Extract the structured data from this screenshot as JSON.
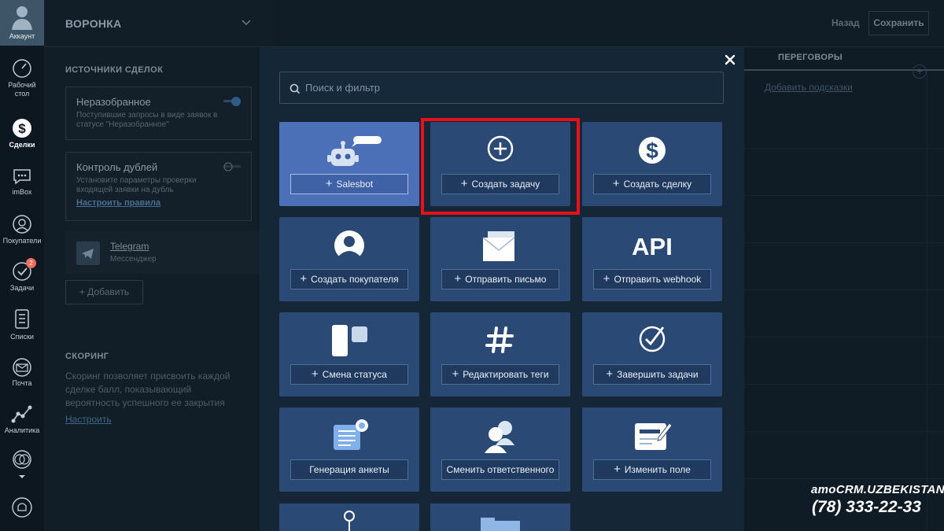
{
  "nav": {
    "account_label": "Аккаунт",
    "items": [
      {
        "label": "Рабочий стол",
        "icon": "dashboard-gauge-icon"
      },
      {
        "label": "Сделки",
        "icon": "deals-dollar-icon"
      },
      {
        "label": "imBox",
        "icon": "chat-bubble-icon"
      },
      {
        "label": "Покупатели",
        "icon": "customer-icon"
      },
      {
        "label": "Задачи",
        "icon": "tasks-check-icon",
        "badge": "2"
      },
      {
        "label": "Списки",
        "icon": "lists-icon"
      },
      {
        "label": "Почта",
        "icon": "mail-envelope-icon"
      },
      {
        "label": "Аналитика",
        "icon": "analytics-chart-icon"
      }
    ]
  },
  "panel": {
    "title": "ВОРОНКА",
    "sources_title": "ИСТОЧНИКИ СДЕЛОК",
    "unsorted": {
      "name": "Неразобранное",
      "desc": "Поступившие запросы в виде заявок в статусе \"Неразобранное\""
    },
    "duplicates": {
      "name": "Контроль дублей",
      "desc": "Установите параметры проверки входящей заявки на дубль",
      "link": "Настроить правила"
    },
    "telegram": {
      "name": "Telegram",
      "sub": "Мессенджер"
    },
    "add_button": "+ Добавить",
    "scoring_title": "СКОРИНГ",
    "scoring_desc": "Скоринг позволяет присвоить каждой сделке балл, показывающий вероятность успешного ее закрытия",
    "scoring_link": "Настроить"
  },
  "header": {
    "back": "Назад",
    "save": "Сохранить"
  },
  "column": {
    "name": "ПЕРЕГОВОРЫ",
    "hints_link": "Добавить подсказки"
  },
  "modal": {
    "close": "×",
    "search_placeholder": "Поиск и фильтр",
    "tiles": [
      {
        "label": "Salesbot",
        "icon": "robot-icon"
      },
      {
        "label": "Создать задачу",
        "icon": "plus-circle-icon"
      },
      {
        "label": "Создать сделку",
        "icon": "dollar-coin-icon"
      },
      {
        "label": "Создать покупателя",
        "icon": "customer-head-icon"
      },
      {
        "label": "Отправить письмо",
        "icon": "envelope-icon"
      },
      {
        "label": "Отправить webhook",
        "icon": "api-icon"
      },
      {
        "label": "Смена статуса",
        "icon": "status-cards-icon"
      },
      {
        "label": "Редактировать теги",
        "icon": "hashtag-icon"
      },
      {
        "label": "Завершить задачи",
        "icon": "check-circle-icon"
      },
      {
        "label": "Генерация анкеты",
        "icon": "form-list-icon"
      },
      {
        "label": "Сменить ответственного",
        "icon": "swap-users-icon"
      },
      {
        "label": "Изменить поле",
        "icon": "edit-field-icon"
      }
    ],
    "api_text": "API"
  },
  "watermark": {
    "brand": "amoCRM.UZBEKISTAN",
    "phone": "(78) 333-22-33"
  }
}
